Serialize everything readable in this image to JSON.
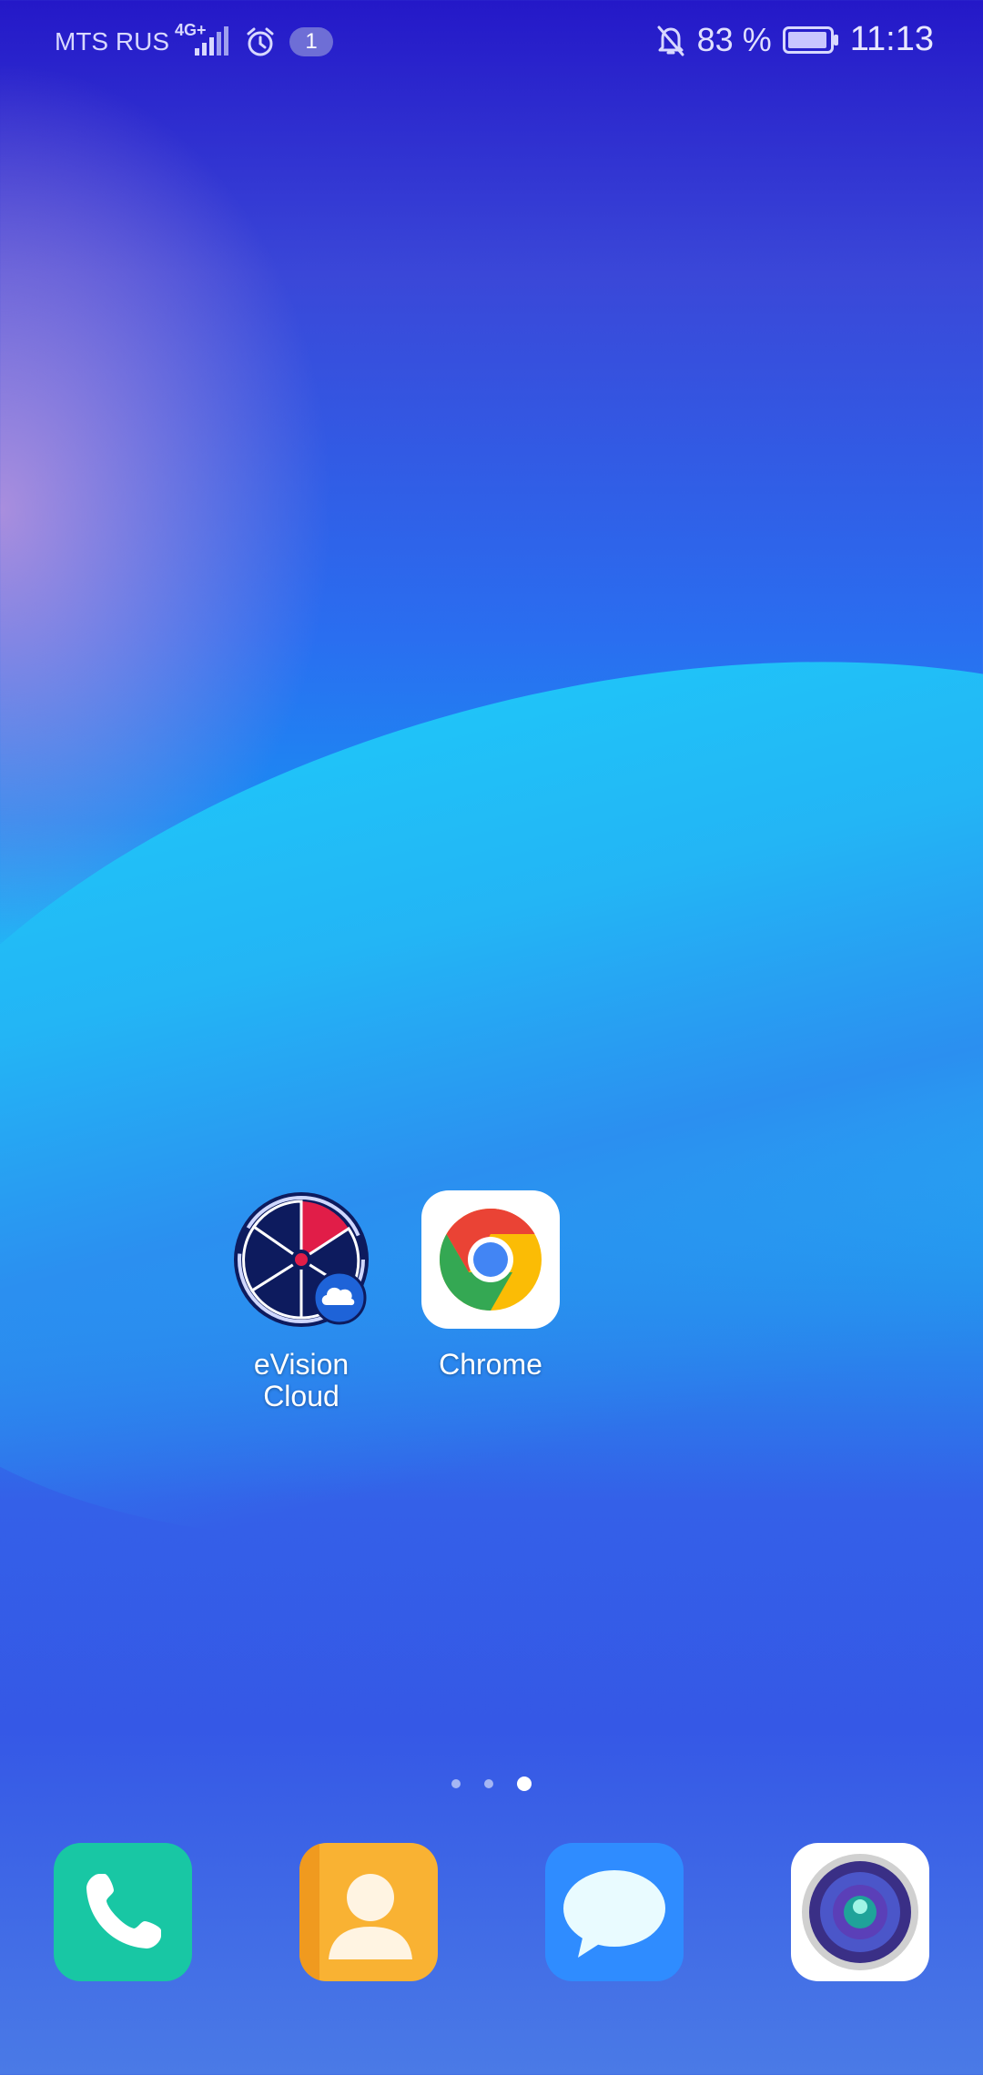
{
  "status_bar": {
    "carrier": "MTS RUS",
    "network": "4G+",
    "notification_count": "1",
    "battery_percent": "83 %",
    "time": "11:13",
    "icons": [
      "signal-icon",
      "alarm-icon",
      "bell-off-icon",
      "battery-icon"
    ]
  },
  "home_apps": [
    {
      "label_line1": "eVision",
      "label_line2": "Cloud",
      "icon": "evision-cloud-icon"
    },
    {
      "label_line1": "Chrome",
      "label_line2": "",
      "icon": "chrome-icon"
    }
  ],
  "page_indicator": {
    "pages": 3,
    "active_index": 2
  },
  "dock": [
    {
      "icon": "phone-icon",
      "color": "#18c7a4"
    },
    {
      "icon": "contacts-icon",
      "color": "#f9b233"
    },
    {
      "icon": "messages-icon",
      "color": "#2f8cff"
    },
    {
      "icon": "camera-icon",
      "color": "#ffffff"
    }
  ]
}
